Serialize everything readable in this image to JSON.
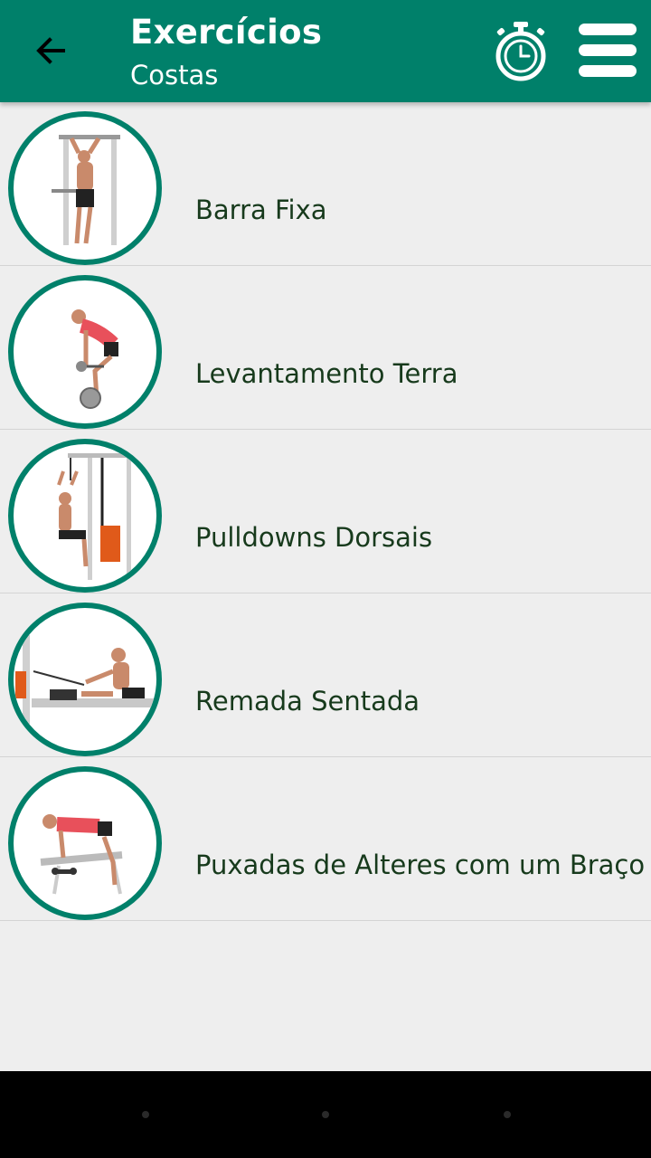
{
  "header": {
    "title": "Exercícios",
    "subtitle": "Costas",
    "back_icon": "arrow-left-icon",
    "timer_icon": "stopwatch-icon",
    "menu_icon": "hamburger-menu-icon",
    "accent_color": "#00806a"
  },
  "exercises": [
    {
      "label": "Barra Fixa",
      "image": "pull-up-image"
    },
    {
      "label": "Levantamento Terra",
      "image": "deadlift-image"
    },
    {
      "label": "Pulldowns Dorsais",
      "image": "lat-pulldown-image"
    },
    {
      "label": "Remada Sentada",
      "image": "seated-row-image"
    },
    {
      "label": "Puxadas de Alteres com um Braço",
      "image": "one-arm-dumbbell-row-image"
    }
  ]
}
